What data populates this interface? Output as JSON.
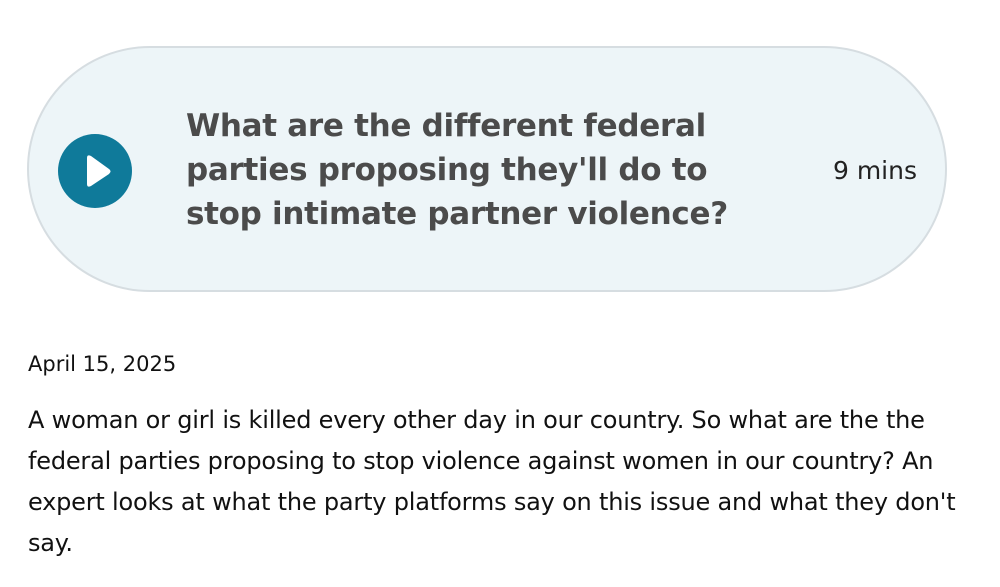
{
  "episode": {
    "title": "What are the different federal parties proposing they'll do to stop intimate partner violence?",
    "duration": "9 mins",
    "play_icon": "play-icon",
    "date": "April 15, 2025",
    "description": "A woman or girl is killed every other day in our country. So what are the the federal parties proposing to stop violence against women in our country? An expert looks at what the party platforms say on this issue and what they don't say."
  },
  "colors": {
    "play_button": "#0f7a9a",
    "pill_background": "#edf5f8",
    "pill_border": "#d6dde1",
    "title_text": "#4b4b4b"
  }
}
